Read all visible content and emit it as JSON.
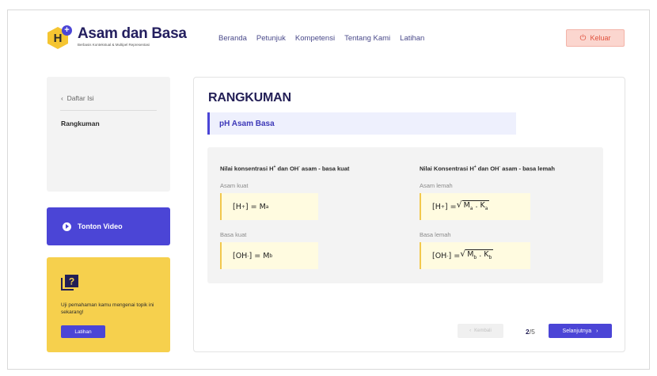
{
  "header": {
    "logo_letter": "H",
    "logo_badge": "+",
    "brand_title": "Asam dan Basa",
    "brand_subtitle": "Berbasis Kontekstual & Multipel Representasi",
    "nav": [
      "Beranda",
      "Petunjuk",
      "Kompetensi",
      "Tentang Kami",
      "Latihan"
    ],
    "logout_label": "Keluar"
  },
  "sidebar": {
    "toc_back": "Daftar Isi",
    "toc_items": [
      "Rangkuman"
    ],
    "video_label": "Tonton Video",
    "quiz_text": "Uji pemahaman kamu mengenai topik ini sekarang!",
    "quiz_button": "Latihan"
  },
  "main": {
    "title": "RANGKUMAN",
    "section": "pH Asam Basa",
    "left": {
      "heading_pre": "Nilai konsentrasi H",
      "heading_mid": " dan OH",
      "heading_post": " asam - basa kuat",
      "acid_label": "Asam kuat",
      "base_label": "Basa  kuat"
    },
    "right": {
      "heading_pre": "Nilai Konsentrasi H",
      "heading_mid": " dan OH",
      "heading_post": " asam - basa lemah",
      "acid_label": "Asam lemah",
      "base_label": "Basa lemah"
    }
  },
  "pagination": {
    "prev_label": "Kembali",
    "current": "2",
    "total": "/5",
    "next_label": "Selanjutnya"
  },
  "colors": {
    "primary": "#4b45d6",
    "accent_yellow": "#f6d04d",
    "logout_bg": "#fbd6cf",
    "logout_text": "#e0503c"
  }
}
